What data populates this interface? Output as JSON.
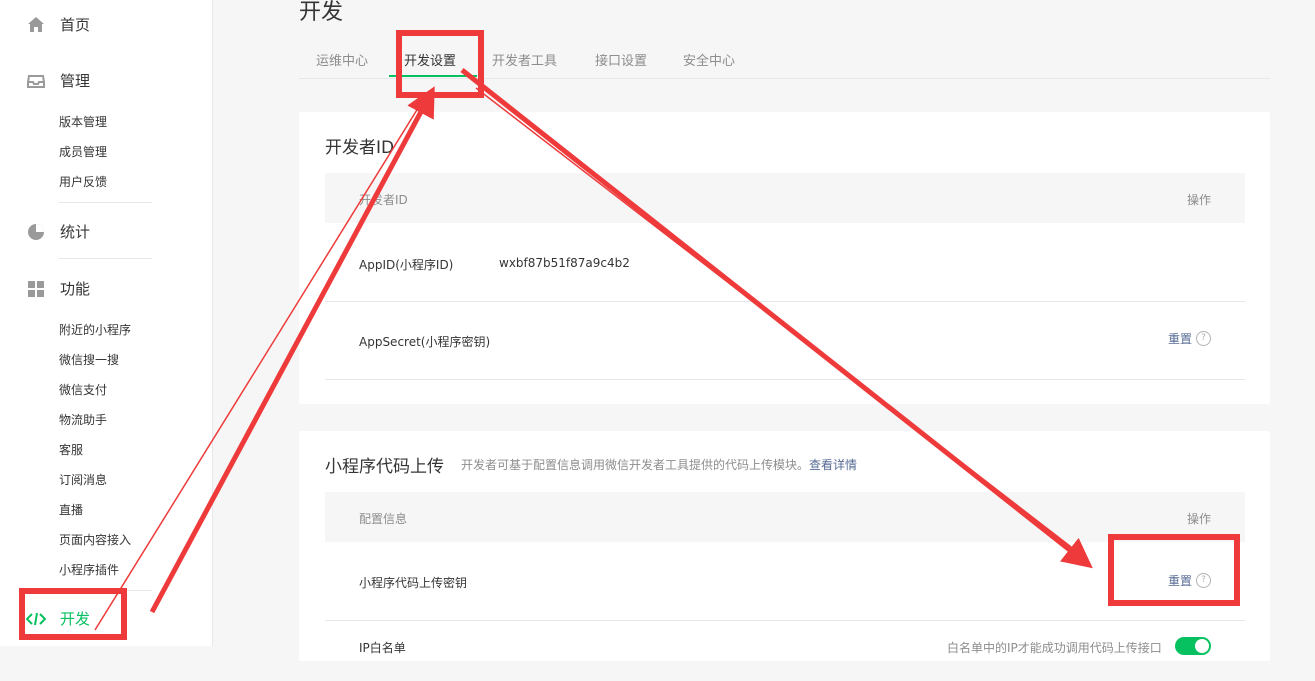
{
  "sidebar": {
    "home": {
      "label": "首页",
      "icon": "home-icon"
    },
    "manage": {
      "label": "管理",
      "icon": "inbox-icon",
      "items": [
        "版本管理",
        "成员管理",
        "用户反馈"
      ]
    },
    "stats": {
      "label": "统计",
      "icon": "pie-chart-icon"
    },
    "features": {
      "label": "功能",
      "icon": "grid-icon",
      "items": [
        "附近的小程序",
        "微信搜一搜",
        "微信支付",
        "物流助手",
        "客服",
        "订阅消息",
        "直播",
        "页面内容接入",
        "小程序插件"
      ]
    },
    "develop": {
      "label": "开发",
      "icon": "code-icon"
    }
  },
  "page_title": "开发",
  "tabs": [
    {
      "label": "运维中心",
      "active": false
    },
    {
      "label": "开发设置",
      "active": true
    },
    {
      "label": "开发者工具",
      "active": false
    },
    {
      "label": "接口设置",
      "active": false
    },
    {
      "label": "安全中心",
      "active": false
    }
  ],
  "dev_id_card": {
    "title": "开发者ID",
    "columns": [
      "开发者ID",
      "操作"
    ],
    "rows": [
      {
        "name": "AppID(小程序ID)",
        "value": "wxbf87b51f87a9c4b2",
        "action": ""
      },
      {
        "name": "AppSecret(小程序密钥)",
        "value": "",
        "action": "重置"
      }
    ]
  },
  "upload_card": {
    "title": "小程序代码上传",
    "desc": "开发者可基于配置信息调用微信开发者工具提供的代码上传模块。",
    "desc_link": "查看详情",
    "columns": [
      "配置信息",
      "操作"
    ],
    "rows": [
      {
        "name": "小程序代码上传密钥",
        "action": "重置"
      },
      {
        "name": "IP白名单",
        "hint": "白名单中的IP才能成功调用代码上传接口",
        "toggle_on": true
      }
    ]
  },
  "colors": {
    "accent": "#07c160",
    "annotation": "#ee3a3a",
    "link": "#576b95"
  }
}
